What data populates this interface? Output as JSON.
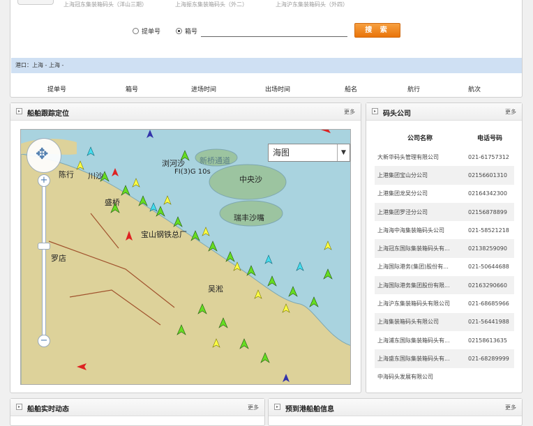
{
  "terminals": [
    "上海冠东集装箱码头（洋山三期）",
    "上海振东集装箱码头（外二）",
    "上海沪东集装箱码头（外四）"
  ],
  "search": {
    "option_a": "提单号",
    "option_b": "箱号",
    "button": "搜 索",
    "selected": "箱号",
    "value": ""
  },
  "route_bar": "港口：上海 - 上海 -",
  "columns": [
    "提单号",
    "箱号",
    "进场时间",
    "出场时间",
    "船名",
    "航行",
    "航次"
  ],
  "map_panel": {
    "title": "船舶跟踪定位",
    "more": "更多",
    "map_type": "海图"
  },
  "map_labels": [
    "陈行",
    "川沙",
    "盛桥",
    "宝山钢铁总厂",
    "罗店",
    "吴淞",
    "浏河沙",
    "中央沙",
    "瑞丰沙嘴",
    "新桥通道",
    "FI(3)G 10s"
  ],
  "company_panel": {
    "title": "码头公司",
    "more": "更多",
    "headers": [
      "公司名称",
      "电话号码"
    ],
    "rows": [
      [
        "大新华码头管理有限公司",
        "021-61757312"
      ],
      [
        "上港集团宝山分公司",
        "02156601310"
      ],
      [
        "上港集团龙吴分公司",
        "02164342300"
      ],
      [
        "上港集团罗泾分公司",
        "02156878899"
      ],
      [
        "上海海中海集装箱码头公司",
        "021-58521218"
      ],
      [
        "上海冠东国际集装箱码头有...",
        "02138259090"
      ],
      [
        "上海国际港务(集团)股份有...",
        "021-50644688"
      ],
      [
        "上海国际港务集团股份有限...",
        "02163290660"
      ],
      [
        "上海沪东集装箱码头有限公司",
        "021-68685966"
      ],
      [
        "上海集装箱码头有限公司",
        "021-56441988"
      ],
      [
        "上海浦东国际集装箱码头有...",
        "02158613635"
      ],
      [
        "上海盛东国际集装箱码头有...",
        "021-68289999"
      ],
      [
        "中海码头发展有限公司",
        ""
      ]
    ]
  },
  "bottom_left": {
    "title": "船舶实时动态",
    "more": "更多"
  },
  "bottom_right": {
    "title": "预到港船舶信息",
    "more": "更多"
  },
  "colors": {
    "water": "#a9d3df",
    "land": "#ddd29a",
    "shoal": "#9cc4a0",
    "accent": "#e9740a",
    "bar": "#cfe0f3"
  }
}
